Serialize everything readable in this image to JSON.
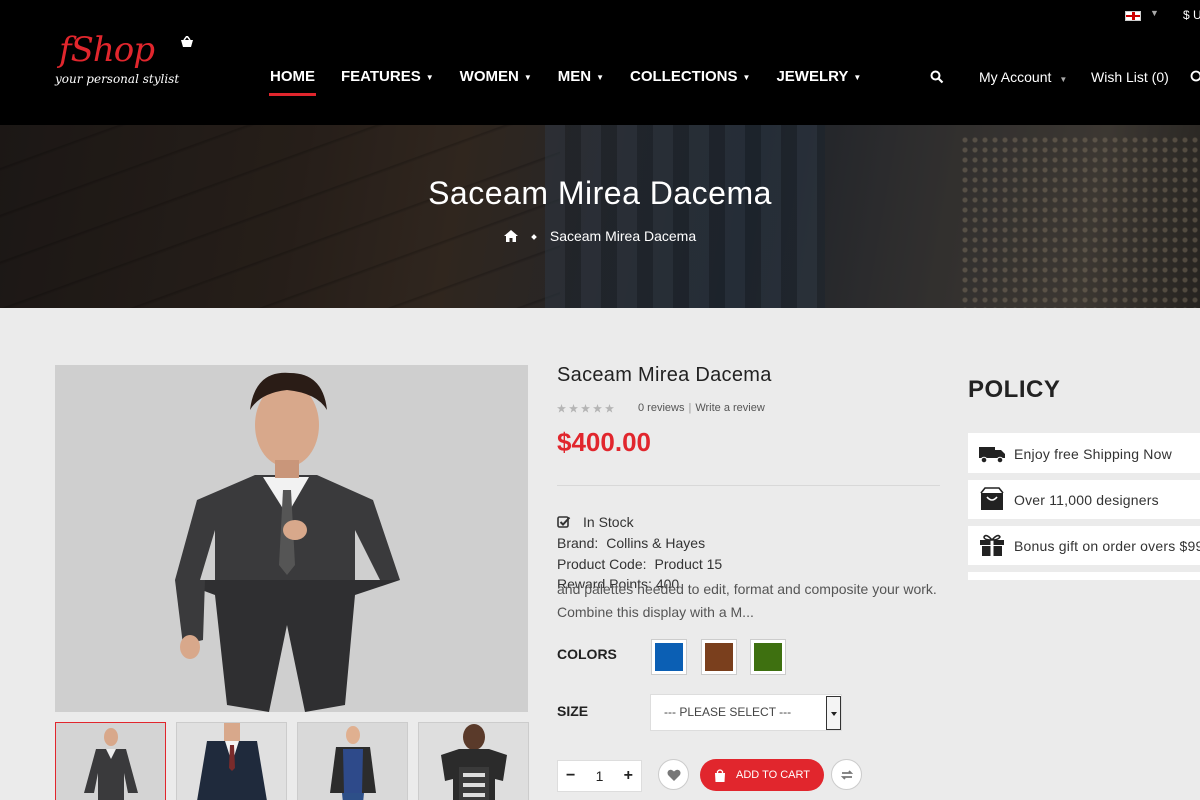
{
  "header": {
    "logo_text": "fShop",
    "logo_tagline": "your personal stylist",
    "currency": "$ U",
    "nav": [
      {
        "label": "HOME",
        "active": true
      },
      {
        "label": "FEATURES",
        "dropdown": true
      },
      {
        "label": "WOMEN",
        "dropdown": true
      },
      {
        "label": "MEN",
        "dropdown": true
      },
      {
        "label": "COLLECTIONS",
        "dropdown": true
      },
      {
        "label": "JEWELRY",
        "dropdown": true
      }
    ],
    "account_label": "My Account",
    "wishlist_label": "Wish List (0)"
  },
  "banner": {
    "title": "Saceam Mirea Dacema",
    "breadcrumb_current": "Saceam Mirea Dacema"
  },
  "product": {
    "title": "Saceam Mirea Dacema",
    "rating": 0,
    "rating_max": 5,
    "reviews_label": "0 reviews",
    "write_review_label": "Write a review",
    "price": "$400.00",
    "stock": "In Stock",
    "brand_label": "Brand:",
    "brand_value": "Collins & Hayes",
    "code_label": "Product Code:",
    "code_value": "Product 15",
    "reward_text": "Reward Points: 400",
    "description": "and palettes needed to edit, format and composite your work. Combine this display with a M...",
    "colors_label": "COLORS",
    "colors": [
      "#0b5fb4",
      "#7a3f1d",
      "#3e7010"
    ],
    "size_label": "SIZE",
    "size_placeholder": "--- PLEASE SELECT ---",
    "quantity": "1",
    "add_to_cart_label": "ADD TO CART"
  },
  "policy": {
    "title": "POLICY",
    "items": [
      {
        "icon": "truck-icon",
        "text": "Enjoy free Shipping Now"
      },
      {
        "icon": "bag-icon",
        "text": "Over 11,000 designers"
      },
      {
        "icon": "gift-icon",
        "text": "Bonus gift on order overs $99"
      }
    ]
  },
  "colors": {
    "accent": "#e1262d",
    "header_bg": "#000000",
    "page_bg": "#ebebeb"
  }
}
